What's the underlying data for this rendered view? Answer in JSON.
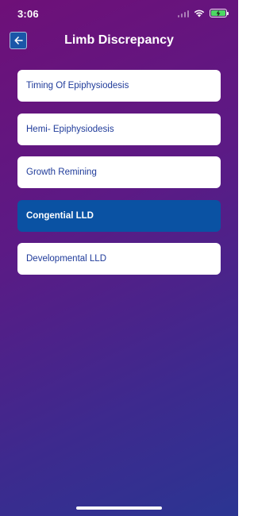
{
  "status_bar": {
    "time": "3:06",
    "icons": [
      "signal-icon",
      "wifi-icon",
      "battery-charging-icon"
    ]
  },
  "header": {
    "back_icon": "arrow-left-icon",
    "title": "Limb Discrepancy"
  },
  "menu": {
    "items": [
      {
        "label": "Timing Of Epiphysiodesis",
        "active": false
      },
      {
        "label": "Hemi- Epiphysiodesis",
        "active": false
      },
      {
        "label": "Growth Remining",
        "active": false
      },
      {
        "label": "Congential LLD",
        "active": true
      },
      {
        "label": "Developmental LLD",
        "active": false
      }
    ]
  },
  "colors": {
    "gradient_start": "#6e1078",
    "gradient_end": "#2b3592",
    "item_background": "#ffffff",
    "item_text": "#1f3b9a",
    "active_background": "#0a52a3",
    "active_text": "#ffffff",
    "back_button": "#1a56a8"
  }
}
